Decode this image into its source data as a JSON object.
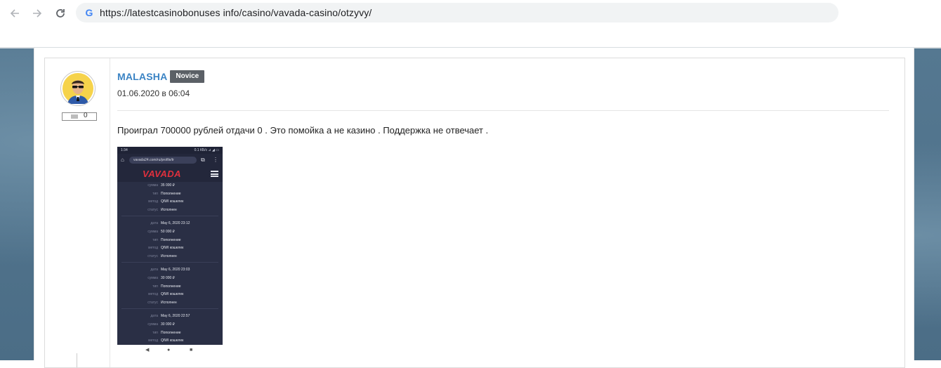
{
  "browser": {
    "url": "https://latestcasinobonuses info/casino/vavada-casino/otzyvy/",
    "icons": {
      "back": "arrow-left-icon",
      "forward": "arrow-right-icon",
      "reload": "reload-icon",
      "site": "google-icon"
    }
  },
  "review": {
    "author": "MALASHA",
    "rank_badge": "Novice",
    "date": "01.06.2020 в 06:04",
    "rating_value": "0",
    "text": "Проиграл 700000 рублей отдачи 0 . Это помойка а не казино . Поддержка не отвечает ."
  },
  "screenshot": {
    "status_left": "1:34",
    "status_right": "0.1 КБ/с ⊿ ◢ ▭",
    "url": "vavada24.com/ru/profile/tr",
    "logo": "VAVADA",
    "groups": [
      [
        {
          "key": "сумма",
          "value": "35 000 ₽"
        },
        {
          "key": "тип",
          "value": "Пополнение"
        },
        {
          "key": "метод",
          "value": "QIWI кошелек"
        },
        {
          "key": "статус",
          "value": "Исполнен"
        }
      ],
      [
        {
          "key": "дата",
          "value": "May 6, 2020 23:12"
        },
        {
          "key": "сумма",
          "value": "50 000 ₽"
        },
        {
          "key": "тип",
          "value": "Пополнение"
        },
        {
          "key": "метод",
          "value": "QIWI кошелек"
        },
        {
          "key": "статус",
          "value": "Исполнен"
        }
      ],
      [
        {
          "key": "дата",
          "value": "May 6, 2020 23:03"
        },
        {
          "key": "сумма",
          "value": "30 000 ₽"
        },
        {
          "key": "тип",
          "value": "Пополнение"
        },
        {
          "key": "метод",
          "value": "QIWI кошелек"
        },
        {
          "key": "статус",
          "value": "Исполнен"
        }
      ],
      [
        {
          "key": "дата",
          "value": "May 6, 2020 22:57"
        },
        {
          "key": "сумма",
          "value": "30 000 ₽"
        },
        {
          "key": "тип",
          "value": "Пополнение"
        },
        {
          "key": "метод",
          "value": "QIWI кошелек"
        }
      ]
    ],
    "navbar": [
      "◀",
      "●",
      "■"
    ]
  },
  "colors": {
    "author": "#3a83c4",
    "badge_bg": "#5b6066",
    "site_bg": "#557891",
    "vavada_red": "#e0303d",
    "phone_bg": "#2a2f45"
  }
}
